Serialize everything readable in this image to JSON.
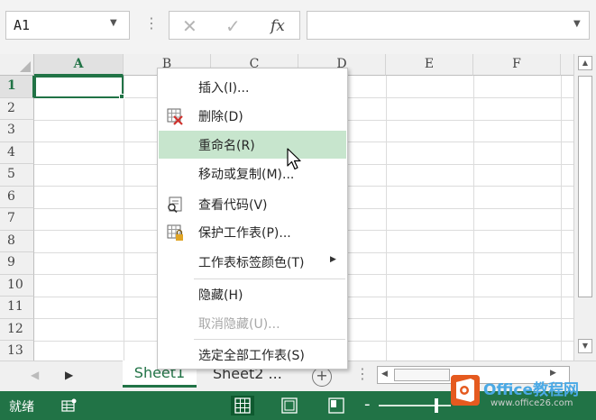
{
  "formula_bar": {
    "name_box": "A1",
    "cancel_icon": "✕",
    "enter_icon": "✓",
    "fx_label": "fx",
    "formula": ""
  },
  "grid": {
    "columns": [
      "A",
      "B",
      "C",
      "D",
      "E",
      "F"
    ],
    "rows": [
      "1",
      "2",
      "3",
      "4",
      "5",
      "6",
      "7",
      "8",
      "9",
      "10",
      "11",
      "12",
      "13"
    ],
    "selected_cell": "A1"
  },
  "context_menu": {
    "items": [
      {
        "label": "插入(I)...",
        "icon": "",
        "disabled": false
      },
      {
        "label": "删除(D)",
        "icon": "delete-sheet-icon",
        "disabled": false
      },
      {
        "label": "重命名(R)",
        "icon": "",
        "disabled": false,
        "highlighted": true
      },
      {
        "label": "移动或复制(M)...",
        "icon": "",
        "disabled": false
      },
      {
        "label": "查看代码(V)",
        "icon": "view-code-icon",
        "disabled": false
      },
      {
        "label": "保护工作表(P)...",
        "icon": "protect-sheet-icon",
        "disabled": false
      },
      {
        "label": "工作表标签颜色(T)",
        "icon": "",
        "disabled": false,
        "submenu": true
      },
      {
        "label": "隐藏(H)",
        "icon": "",
        "disabled": false
      },
      {
        "label": "取消隐藏(U)...",
        "icon": "",
        "disabled": true
      },
      {
        "label": "选定全部工作表(S)",
        "icon": "",
        "disabled": false
      }
    ]
  },
  "sheet_tabs": {
    "tabs": [
      "Sheet1",
      "Sheet2 ..."
    ],
    "active": "Sheet1",
    "add_label": "+",
    "more_label": "⋮"
  },
  "status_bar": {
    "status": "就绪",
    "zoom_minus": "-"
  },
  "watermark": {
    "text": "Office教程网",
    "url": "www.office26.com"
  },
  "colors": {
    "accent": "#217346",
    "menu_hover": "#c7e5cd"
  }
}
